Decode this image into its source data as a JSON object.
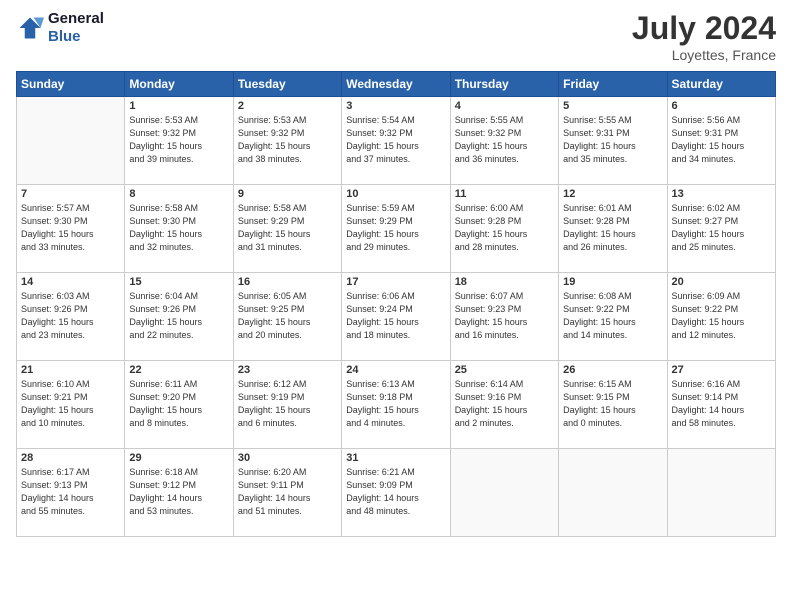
{
  "logo": {
    "general": "General",
    "blue": "Blue"
  },
  "header": {
    "month": "July 2024",
    "location": "Loyettes, France"
  },
  "days": [
    "Sunday",
    "Monday",
    "Tuesday",
    "Wednesday",
    "Thursday",
    "Friday",
    "Saturday"
  ],
  "weeks": [
    [
      {
        "day": "",
        "content": ""
      },
      {
        "day": "1",
        "content": "Sunrise: 5:53 AM\nSunset: 9:32 PM\nDaylight: 15 hours\nand 39 minutes."
      },
      {
        "day": "2",
        "content": "Sunrise: 5:53 AM\nSunset: 9:32 PM\nDaylight: 15 hours\nand 38 minutes."
      },
      {
        "day": "3",
        "content": "Sunrise: 5:54 AM\nSunset: 9:32 PM\nDaylight: 15 hours\nand 37 minutes."
      },
      {
        "day": "4",
        "content": "Sunrise: 5:55 AM\nSunset: 9:32 PM\nDaylight: 15 hours\nand 36 minutes."
      },
      {
        "day": "5",
        "content": "Sunrise: 5:55 AM\nSunset: 9:31 PM\nDaylight: 15 hours\nand 35 minutes."
      },
      {
        "day": "6",
        "content": "Sunrise: 5:56 AM\nSunset: 9:31 PM\nDaylight: 15 hours\nand 34 minutes."
      }
    ],
    [
      {
        "day": "7",
        "content": "Sunrise: 5:57 AM\nSunset: 9:30 PM\nDaylight: 15 hours\nand 33 minutes."
      },
      {
        "day": "8",
        "content": "Sunrise: 5:58 AM\nSunset: 9:30 PM\nDaylight: 15 hours\nand 32 minutes."
      },
      {
        "day": "9",
        "content": "Sunrise: 5:58 AM\nSunset: 9:29 PM\nDaylight: 15 hours\nand 31 minutes."
      },
      {
        "day": "10",
        "content": "Sunrise: 5:59 AM\nSunset: 9:29 PM\nDaylight: 15 hours\nand 29 minutes."
      },
      {
        "day": "11",
        "content": "Sunrise: 6:00 AM\nSunset: 9:28 PM\nDaylight: 15 hours\nand 28 minutes."
      },
      {
        "day": "12",
        "content": "Sunrise: 6:01 AM\nSunset: 9:28 PM\nDaylight: 15 hours\nand 26 minutes."
      },
      {
        "day": "13",
        "content": "Sunrise: 6:02 AM\nSunset: 9:27 PM\nDaylight: 15 hours\nand 25 minutes."
      }
    ],
    [
      {
        "day": "14",
        "content": "Sunrise: 6:03 AM\nSunset: 9:26 PM\nDaylight: 15 hours\nand 23 minutes."
      },
      {
        "day": "15",
        "content": "Sunrise: 6:04 AM\nSunset: 9:26 PM\nDaylight: 15 hours\nand 22 minutes."
      },
      {
        "day": "16",
        "content": "Sunrise: 6:05 AM\nSunset: 9:25 PM\nDaylight: 15 hours\nand 20 minutes."
      },
      {
        "day": "17",
        "content": "Sunrise: 6:06 AM\nSunset: 9:24 PM\nDaylight: 15 hours\nand 18 minutes."
      },
      {
        "day": "18",
        "content": "Sunrise: 6:07 AM\nSunset: 9:23 PM\nDaylight: 15 hours\nand 16 minutes."
      },
      {
        "day": "19",
        "content": "Sunrise: 6:08 AM\nSunset: 9:22 PM\nDaylight: 15 hours\nand 14 minutes."
      },
      {
        "day": "20",
        "content": "Sunrise: 6:09 AM\nSunset: 9:22 PM\nDaylight: 15 hours\nand 12 minutes."
      }
    ],
    [
      {
        "day": "21",
        "content": "Sunrise: 6:10 AM\nSunset: 9:21 PM\nDaylight: 15 hours\nand 10 minutes."
      },
      {
        "day": "22",
        "content": "Sunrise: 6:11 AM\nSunset: 9:20 PM\nDaylight: 15 hours\nand 8 minutes."
      },
      {
        "day": "23",
        "content": "Sunrise: 6:12 AM\nSunset: 9:19 PM\nDaylight: 15 hours\nand 6 minutes."
      },
      {
        "day": "24",
        "content": "Sunrise: 6:13 AM\nSunset: 9:18 PM\nDaylight: 15 hours\nand 4 minutes."
      },
      {
        "day": "25",
        "content": "Sunrise: 6:14 AM\nSunset: 9:16 PM\nDaylight: 15 hours\nand 2 minutes."
      },
      {
        "day": "26",
        "content": "Sunrise: 6:15 AM\nSunset: 9:15 PM\nDaylight: 15 hours\nand 0 minutes."
      },
      {
        "day": "27",
        "content": "Sunrise: 6:16 AM\nSunset: 9:14 PM\nDaylight: 14 hours\nand 58 minutes."
      }
    ],
    [
      {
        "day": "28",
        "content": "Sunrise: 6:17 AM\nSunset: 9:13 PM\nDaylight: 14 hours\nand 55 minutes."
      },
      {
        "day": "29",
        "content": "Sunrise: 6:18 AM\nSunset: 9:12 PM\nDaylight: 14 hours\nand 53 minutes."
      },
      {
        "day": "30",
        "content": "Sunrise: 6:20 AM\nSunset: 9:11 PM\nDaylight: 14 hours\nand 51 minutes."
      },
      {
        "day": "31",
        "content": "Sunrise: 6:21 AM\nSunset: 9:09 PM\nDaylight: 14 hours\nand 48 minutes."
      },
      {
        "day": "",
        "content": ""
      },
      {
        "day": "",
        "content": ""
      },
      {
        "day": "",
        "content": ""
      }
    ]
  ]
}
